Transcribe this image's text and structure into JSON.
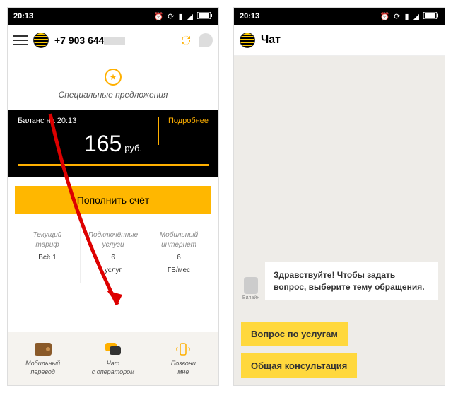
{
  "statusbar": {
    "time": "20:13"
  },
  "phone1": {
    "phoneNumber": "+7 903 644",
    "offers": {
      "label": "Специальные предложения"
    },
    "balance": {
      "asOf": "Баланс на 20:13",
      "more": "Подробнее",
      "amount": "165",
      "currency": "руб."
    },
    "topup": "Пополнить счёт",
    "info": {
      "tariff": {
        "label": "Текущий\nтариф",
        "value": "Всё 1"
      },
      "services": {
        "label": "Подключённые\nуслуги",
        "value1": "6",
        "value2": "услуг"
      },
      "internet": {
        "label": "Мобильный\nинтернет",
        "value1": "6",
        "value2": "ГБ/мес"
      }
    },
    "nav": {
      "transfer": "Мобильный\nперевод",
      "chat": "Чат\nс оператором",
      "call": "Позвони\nмне"
    }
  },
  "phone2": {
    "title": "Чат",
    "avatarLabel": "Билайн",
    "message": "Здравствуйте! Чтобы задать вопрос, выберите тему обращения.",
    "btn1": "Вопрос по услугам",
    "btn2": "Общая консультация"
  }
}
